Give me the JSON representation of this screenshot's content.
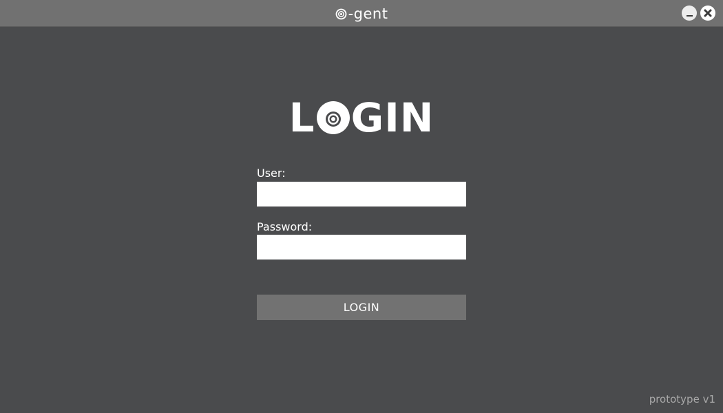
{
  "window": {
    "title": "-gent",
    "logo_icon": "eye-ring-icon",
    "minimize_icon": "minimize-icon",
    "close_icon": "close-icon"
  },
  "login": {
    "heading_start": "L",
    "heading_end": "GIN",
    "heading_eye_icon": "eye-ring-icon",
    "user_label": "User:",
    "user_value": "",
    "password_label": "Password:",
    "password_value": "",
    "submit_label": "LOGIN"
  },
  "footer": {
    "version": "prototype v1"
  },
  "colors": {
    "background": "#4a4b4d",
    "titlebar": "#717171",
    "button": "#727272",
    "text": "#ffffff",
    "muted_text": "#a8a8a8"
  }
}
